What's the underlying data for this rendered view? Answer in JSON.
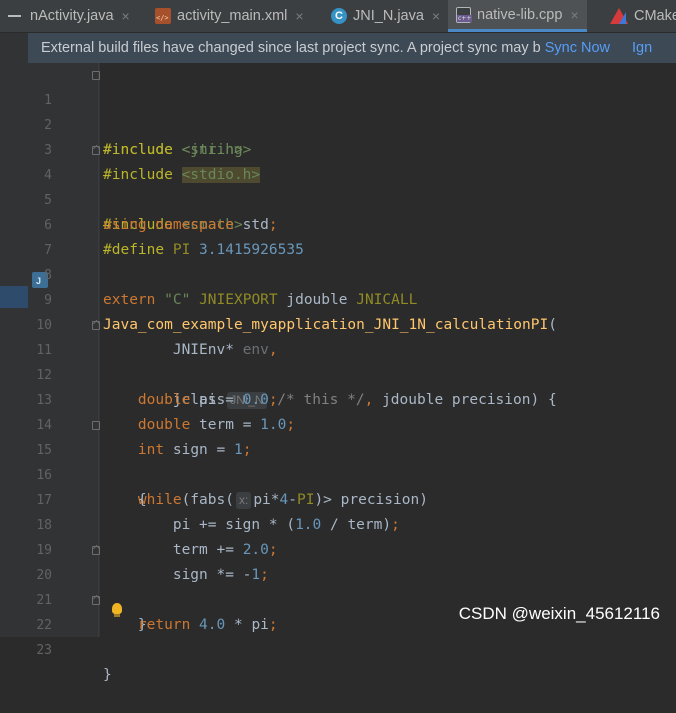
{
  "tabs": [
    {
      "label": "nActivity.java",
      "icon": "none",
      "active": false
    },
    {
      "label": "activity_main.xml",
      "icon": "xml-file-icon",
      "active": false
    },
    {
      "label": "JNI_N.java",
      "icon": "java-class-icon",
      "active": false
    },
    {
      "label": "native-lib.cpp",
      "icon": "cpp-file-icon",
      "active": true
    },
    {
      "label": "CMake",
      "icon": "cmake-icon",
      "active": false
    }
  ],
  "tab_close": "×",
  "notice": {
    "message": "External build files have changed since last project sync. A project sync may b",
    "sync_now": "Sync Now",
    "ignore": "Ign"
  },
  "editor": {
    "file": "native-lib.cpp",
    "lines": [
      "1",
      "2",
      "3",
      "4",
      "5",
      "6",
      "7",
      "8",
      "9",
      "10",
      "11",
      "12",
      "13",
      "14",
      "15",
      "16",
      "17",
      "18",
      "19",
      "20",
      "21",
      "22",
      "23"
    ],
    "code": [
      "#include <jni.h>",
      "#include <string>",
      "#include <stdio.h>",
      "#include <cmath>",
      "using namespace std;",
      "#define PI 3.1415926535",
      "",
      "extern \"C\" JNIEXPORT jdouble JNICALL",
      "Java_com_example_myapplication_JNI_1N_calculationPI(",
      "        JNIEnv* env,",
      "        jclass JNI_N /* this */, jdouble precision) {",
      "    double pi = 0.0;",
      "    double term = 1.0;",
      "    int sign = 1;",
      "    while(fabs( x: pi*4-PI)> precision)",
      "    {",
      "        pi += sign * (1.0 / term);",
      "        term += 2.0;",
      "        sign *= -1;",
      "    }",
      "    return 4.0 * pi;",
      "}",
      ""
    ],
    "hints": {
      "jclass_param": "JNI_N",
      "fabs_param": "x:"
    }
  },
  "watermark": "CSDN @weixin_45612116",
  "colors": {
    "background": "#2b2b2b",
    "keyword": "#cc7832",
    "string": "#6a8759",
    "number": "#6897bb",
    "function": "#ffc66d",
    "link": "#589df6"
  }
}
